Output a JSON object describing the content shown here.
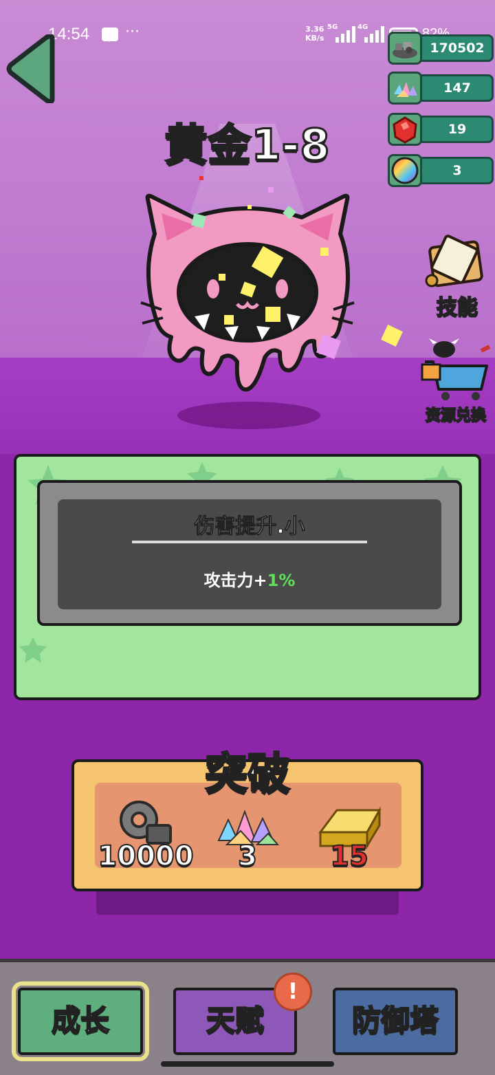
{
  "status_bar": {
    "time": "14:54",
    "speed": "3.36",
    "speed_unit": "KB/s",
    "net1": "5G",
    "net2": "4G",
    "battery": "82%"
  },
  "resources": [
    {
      "icon": "scrap-pile-icon",
      "value": "170502"
    },
    {
      "icon": "crystal-shards-icon",
      "value": "147"
    },
    {
      "icon": "red-gem-icon",
      "value": "19"
    },
    {
      "icon": "rainbow-orb-icon",
      "value": "3"
    }
  ],
  "stage_title": "黄金1-8",
  "side_buttons": {
    "skills": "技能",
    "exchange": "资源兑换"
  },
  "info": {
    "title": "伤害提升.小",
    "desc_prefix": "攻击力+",
    "desc_value": "1%"
  },
  "breakthrough": {
    "title": "突破",
    "costs": [
      {
        "icon": "gear-parts-icon",
        "value": "10000",
        "color": "#ffffff"
      },
      {
        "icon": "crystal-shards-icon",
        "value": "3",
        "color": "#ffffff"
      },
      {
        "icon": "gold-bar-icon",
        "value": "15",
        "color": "#e03030"
      }
    ]
  },
  "nav": {
    "growth": "成长",
    "talent": "天赋",
    "tower": "防御塔",
    "alert": "!"
  },
  "colors": {
    "nav_growth": "#5fae7e",
    "nav_talent": "#8e58b8",
    "nav_tower": "#4c6ba0",
    "info_bg": "#a2e59c",
    "accent_green": "#5ee05a"
  }
}
